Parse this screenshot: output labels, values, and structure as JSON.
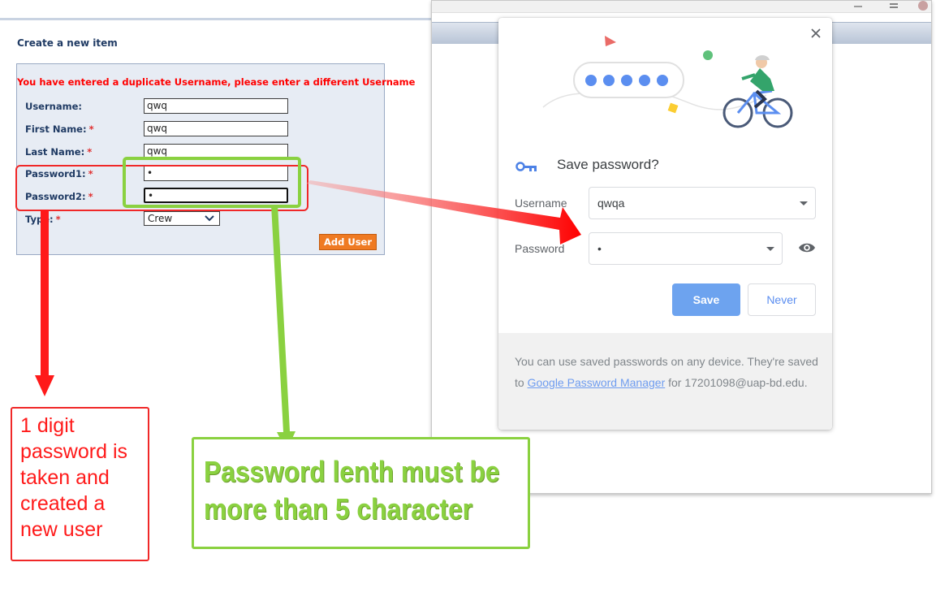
{
  "form": {
    "title": "Create a new item",
    "error": "You have entered a duplicate Username, please enter a different Username",
    "required_marker": "*",
    "fields": [
      {
        "label": "Username:",
        "required": false,
        "value": "qwq"
      },
      {
        "label": "First Name:",
        "required": true,
        "value": "qwq"
      },
      {
        "label": "Last Name:",
        "required": true,
        "value": "qwq"
      },
      {
        "label": "Password1:",
        "required": true,
        "value": "•"
      },
      {
        "label": "Password2:",
        "required": true,
        "value": "•"
      }
    ],
    "type_label": "Type:",
    "type_value": "Crew",
    "add_button": "Add User"
  },
  "popup": {
    "title": "Save password?",
    "username_label": "Username",
    "username_value": "qwqa",
    "password_label": "Password",
    "password_value": "•",
    "save_button": "Save",
    "never_button": "Never",
    "footer_before_link": "You can use saved passwords on any device. They're saved to",
    "footer_link": "Google Password Manager",
    "footer_after_link": "for",
    "footer_email": "17201098@uap-bd.edu."
  },
  "annotations": {
    "red_note": [
      "1 digit",
      "password is",
      "taken and",
      "created a",
      "new user"
    ],
    "green_note": [
      "Password lenth must be",
      "more than 5 character"
    ]
  },
  "colors": {
    "annotation_red": "#f02828",
    "annotation_green": "#8ad140",
    "save_blue": "#6da3ef",
    "add_user_orange": "#ef7a22",
    "form_label": "#203b64"
  }
}
